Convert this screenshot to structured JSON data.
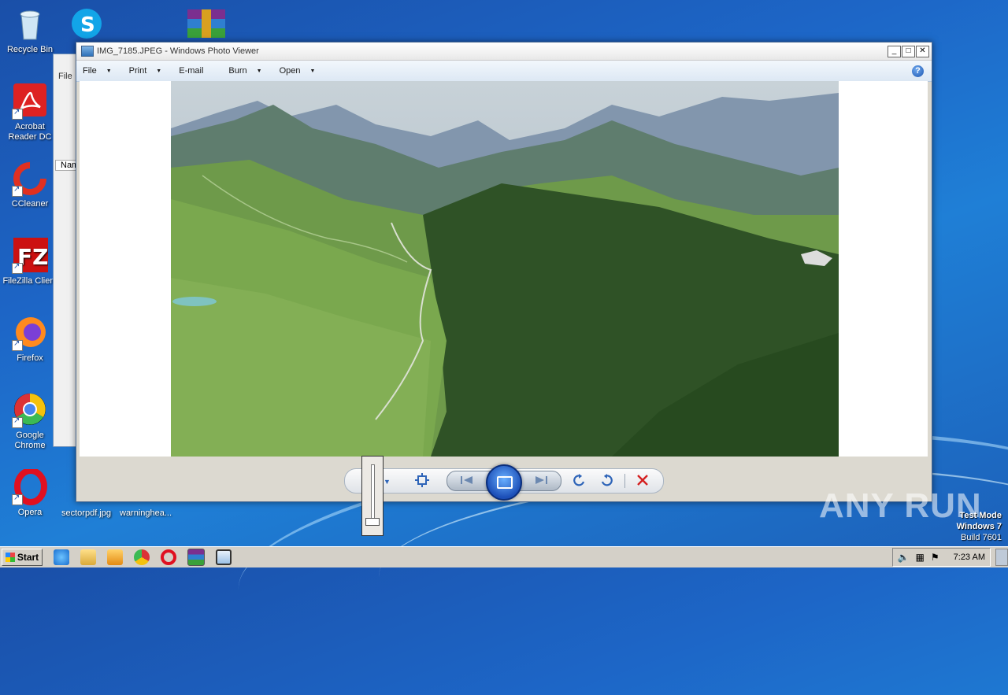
{
  "desktop": {
    "icons": [
      {
        "label": "Recycle Bin",
        "icon": "recycle-bin-icon"
      },
      {
        "label": "Acrobat Reader DC",
        "icon": "acrobat-icon"
      },
      {
        "label": "CCleaner",
        "icon": "ccleaner-icon"
      },
      {
        "label": "FileZilla Client",
        "icon": "filezilla-icon"
      },
      {
        "label": "Firefox",
        "icon": "firefox-icon"
      },
      {
        "label": "Google Chrome",
        "icon": "chrome-icon"
      },
      {
        "label": "Opera",
        "icon": "opera-icon"
      }
    ],
    "bottom_files": [
      "sectorpdf.jpg",
      "warninghea..."
    ],
    "background_window": {
      "menu_file": "File",
      "column_name": "Nam"
    }
  },
  "window": {
    "title": "IMG_7185.JPEG - Windows Photo Viewer",
    "menus": [
      "File",
      "Print",
      "E-mail",
      "Burn",
      "Open"
    ],
    "help_label": "?"
  },
  "taskbar": {
    "start_label": "Start",
    "clock": "7:23 AM"
  },
  "watermark": {
    "line1": "Test Mode",
    "line2": "Windows 7",
    "line3": "Build 7601",
    "brand": "ANY RUN"
  },
  "colors": {
    "desktop_bg": "#1d66c7",
    "accent": "#2e64b8",
    "delete": "#d42020"
  }
}
